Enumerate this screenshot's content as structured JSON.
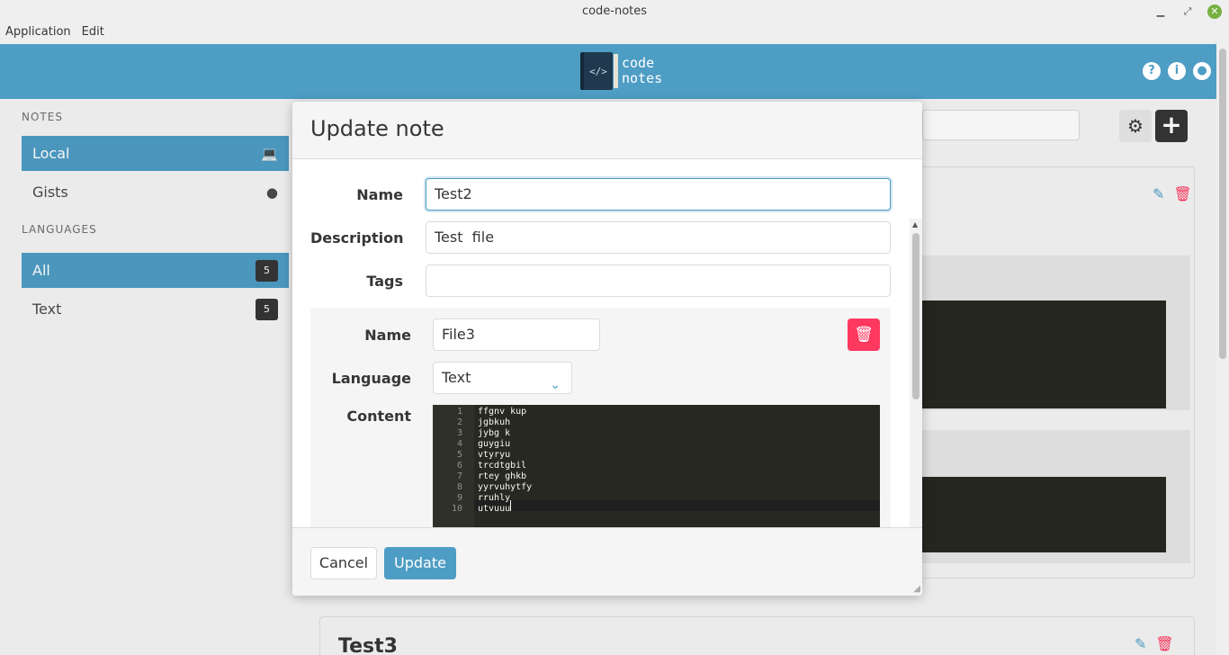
{
  "window": {
    "title": "code-notes",
    "controls": {
      "minimize": "▁",
      "maximize": "⤢",
      "close": "✕"
    }
  },
  "menu": {
    "items": [
      "Application",
      "Edit"
    ]
  },
  "header": {
    "logo_symbol": "</>",
    "logo_line1": "code",
    "logo_line2": "notes",
    "icons": [
      "help-icon",
      "info-icon",
      "github-icon"
    ],
    "help_glyph": "?",
    "info_glyph": "i",
    "github_glyph": "●"
  },
  "sidebar": {
    "notes_heading": "NOTES",
    "notes_items": [
      {
        "label": "Local",
        "icon": "💻"
      },
      {
        "label": "Gists",
        "icon": "●"
      }
    ],
    "languages_heading": "LANGUAGES",
    "languages_items": [
      {
        "label": "All",
        "count": "5"
      },
      {
        "label": "Text",
        "count": "5"
      }
    ]
  },
  "toolbar": {
    "settings_glyph": "⚙",
    "add_glyph": "+"
  },
  "cards": {
    "edit_glyph": "✎",
    "delete_glyph": "🗑",
    "second_title": "Test3"
  },
  "modal": {
    "title": "Update note",
    "name_label": "Name",
    "name_value": "Test2",
    "description_label": "Description",
    "description_value": "Test  file",
    "tags_label": "Tags",
    "tags_value": "",
    "file": {
      "name_label": "Name",
      "name_value": "File3",
      "language_label": "Language",
      "language_value": "Text",
      "content_label": "Content",
      "delete_glyph": "🗑",
      "lines": [
        "ffgnv kup",
        "jgbkuh",
        "jybg k",
        "guygiu",
        "vtyryu",
        "trcdtgbil",
        "rtey ghkb",
        "yyrvuhytfy",
        "rruhly",
        "utvuuu"
      ],
      "line_numbers": [
        "1",
        "2",
        "3",
        "4",
        "5",
        "6",
        "7",
        "8",
        "9",
        "10"
      ]
    },
    "cancel_label": "Cancel",
    "update_label": "Update"
  },
  "colors": {
    "accent": "#4e9dc4",
    "danger": "#ff3860",
    "dark": "#363636",
    "editor_bg": "#272822"
  }
}
